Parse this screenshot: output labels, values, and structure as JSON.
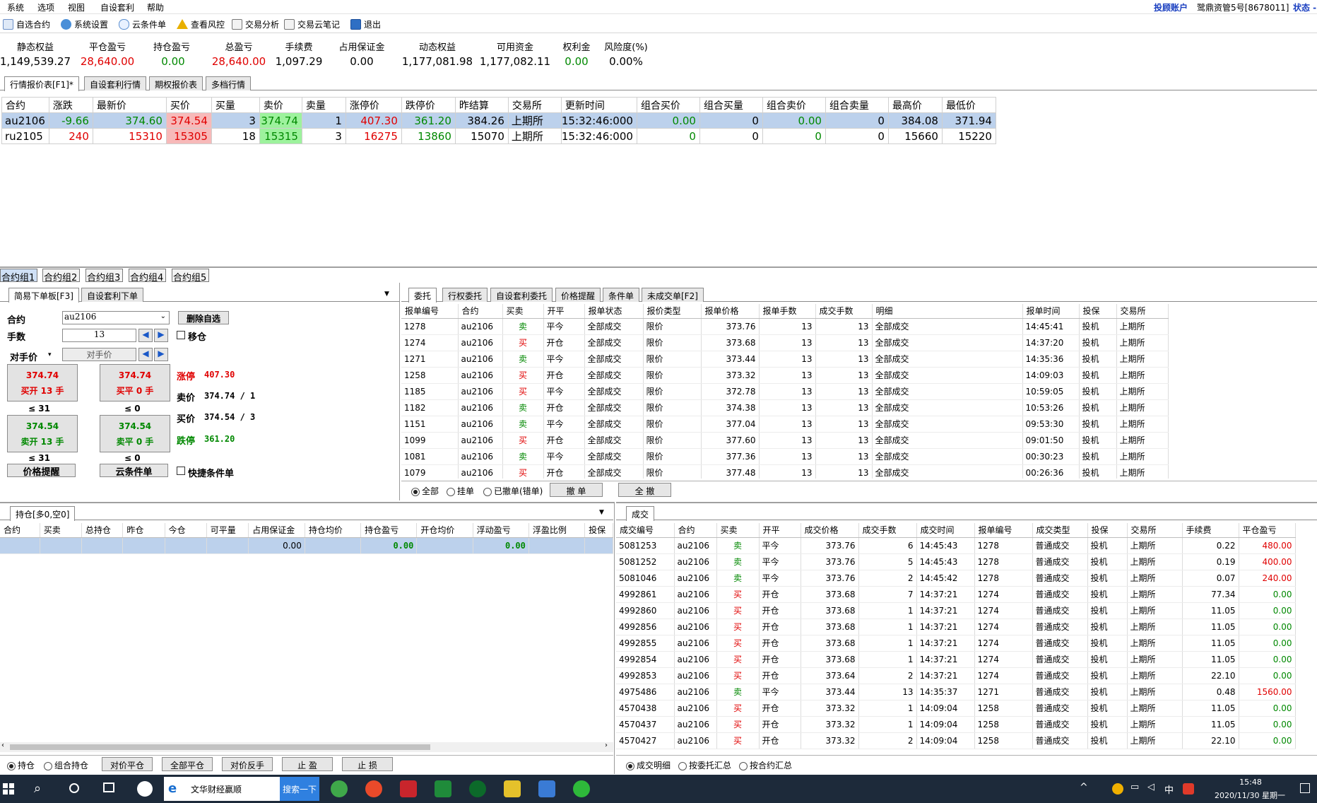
{
  "menu": [
    "系统",
    "选项",
    "视图",
    "自设套利",
    "帮助"
  ],
  "menu_right": {
    "link": "投顾账户",
    "account": "鹭鼎资管5号[8678011]",
    "status": "状态 -"
  },
  "toolbar": [
    "自选合约",
    "系统设置",
    "云条件单",
    "查看风控",
    "交易分析",
    "交易云笔记",
    "退出"
  ],
  "summary": [
    {
      "label": "静态权益",
      "value": "1,149,539.27",
      "color": "#000000"
    },
    {
      "label": "平仓盈亏",
      "value": "28,640.00",
      "color": "#e00000"
    },
    {
      "label": "持仓盈亏",
      "value": "0.00",
      "color": "#008800"
    },
    {
      "label": "总盈亏",
      "value": "28,640.00",
      "color": "#e00000"
    },
    {
      "label": "手续费",
      "value": "1,097.29",
      "color": "#000000"
    },
    {
      "label": "占用保证金",
      "value": "0.00",
      "color": "#000000"
    },
    {
      "label": "动态权益",
      "value": "1,177,081.98",
      "color": "#000000"
    },
    {
      "label": "可用资金",
      "value": "1,177,082.11",
      "color": "#000000"
    },
    {
      "label": "权利金",
      "value": "0.00",
      "color": "#008800"
    },
    {
      "label": "风险度(%)",
      "value": "0.00%",
      "color": "#000000"
    }
  ],
  "market_tabs": [
    "行情报价表[F1]*",
    "自设套利行情",
    "期权报价表",
    "多档行情"
  ],
  "market_headers": [
    "合约",
    "涨跌",
    "最新价",
    "买价",
    "买量",
    "卖价",
    "卖量",
    "涨停价",
    "跌停价",
    "昨结算",
    "交易所",
    "更新时间",
    "组合买价",
    "组合买量",
    "组合卖价",
    "组合卖量",
    "最高价",
    "最低价"
  ],
  "market_rows": [
    [
      "au2106",
      "-9.66",
      "374.60",
      "374.54",
      "3",
      "374.74",
      "1",
      "407.30",
      "361.20",
      "384.26",
      "上期所",
      "15:32:46:000",
      "0.00",
      "0",
      "0.00",
      "0",
      "384.08",
      "371.94"
    ],
    [
      "ru2105",
      "240",
      "15310",
      "15305",
      "18",
      "15315",
      "3",
      "16275",
      "13860",
      "15070",
      "上期所",
      "15:32:46:000",
      "0",
      "0",
      "0",
      "0",
      "15660",
      "15220"
    ]
  ],
  "group_tabs": [
    "合约组1",
    "合约组2",
    "合约组3",
    "合约组4",
    "合约组5"
  ],
  "order_tabs": [
    "简易下单板[F3]",
    "自设套利下单"
  ],
  "order": {
    "contract_label": "合约",
    "contract_value": "au2106",
    "delete_btn": "删除自选",
    "qty_label": "手数",
    "qty_value": "13",
    "movepos": "移仓",
    "price_mode": "对手价",
    "price_value": "对手价",
    "buy_open_price": "374.74",
    "buy_open_label": "买开 13 手",
    "buy_close_price": "374.74",
    "buy_close_label": "买平 0 手",
    "sell_open_price": "374.54",
    "sell_open_label": "卖开 13 手",
    "sell_close_price": "374.54",
    "sell_close_label": "卖平 0 手",
    "le1": "≤ 31",
    "le2": "≤ 0",
    "le3": "≤ 31",
    "le4": "≤ 0",
    "limit_up_label": "涨停",
    "limit_up": "407.30",
    "ask_label": "卖价",
    "ask": "374.74 / 1",
    "bid_label": "买价",
    "bid": "374.54 / 3",
    "limit_down_label": "跌停",
    "limit_down": "361.20",
    "price_alert": "价格提醒",
    "cloud_cond": "云条件单",
    "quick_cond": "快捷条件单"
  },
  "orders_tabs": [
    "委托",
    "行权委托",
    "自设套利委托",
    "价格提醒",
    "条件单",
    "未成交单[F2]"
  ],
  "orders_headers": [
    "报单编号",
    "合约",
    "买卖",
    "开平",
    "报单状态",
    "报价类型",
    "报单价格",
    "报单手数",
    "成交手数",
    "明细",
    "报单时间",
    "投保",
    "交易所"
  ],
  "orders_rows": [
    [
      "1278",
      "au2106",
      "卖",
      "平今",
      "全部成交",
      "限价",
      "373.76",
      "13",
      "13",
      "全部成交",
      "14:45:41",
      "投机",
      "上期所"
    ],
    [
      "1274",
      "au2106",
      "买",
      "开仓",
      "全部成交",
      "限价",
      "373.68",
      "13",
      "13",
      "全部成交",
      "14:37:20",
      "投机",
      "上期所"
    ],
    [
      "1271",
      "au2106",
      "卖",
      "平今",
      "全部成交",
      "限价",
      "373.44",
      "13",
      "13",
      "全部成交",
      "14:35:36",
      "投机",
      "上期所"
    ],
    [
      "1258",
      "au2106",
      "买",
      "开仓",
      "全部成交",
      "限价",
      "373.32",
      "13",
      "13",
      "全部成交",
      "14:09:03",
      "投机",
      "上期所"
    ],
    [
      "1185",
      "au2106",
      "买",
      "平今",
      "全部成交",
      "限价",
      "372.78",
      "13",
      "13",
      "全部成交",
      "10:59:05",
      "投机",
      "上期所"
    ],
    [
      "1182",
      "au2106",
      "卖",
      "开仓",
      "全部成交",
      "限价",
      "374.38",
      "13",
      "13",
      "全部成交",
      "10:53:26",
      "投机",
      "上期所"
    ],
    [
      "1151",
      "au2106",
      "卖",
      "平今",
      "全部成交",
      "限价",
      "377.04",
      "13",
      "13",
      "全部成交",
      "09:53:30",
      "投机",
      "上期所"
    ],
    [
      "1099",
      "au2106",
      "买",
      "开仓",
      "全部成交",
      "限价",
      "377.60",
      "13",
      "13",
      "全部成交",
      "09:01:50",
      "投机",
      "上期所"
    ],
    [
      "1081",
      "au2106",
      "卖",
      "平今",
      "全部成交",
      "限价",
      "377.36",
      "13",
      "13",
      "全部成交",
      "00:30:23",
      "投机",
      "上期所"
    ],
    [
      "1079",
      "au2106",
      "买",
      "开仓",
      "全部成交",
      "限价",
      "377.48",
      "13",
      "13",
      "全部成交",
      "00:26:36",
      "投机",
      "上期所"
    ]
  ],
  "orders_bottom": {
    "all": "全部",
    "pending": "挂单",
    "cancelled": "已撤单(错单)",
    "cancel": "撤 单",
    "cancel_all": "全 撤"
  },
  "pos_tabs": [
    "持仓[多0,空0]"
  ],
  "pos_headers": [
    "合约",
    "买卖",
    "总持仓",
    "昨仓",
    "今仓",
    "可平量",
    "占用保证金",
    "持仓均价",
    "持仓盈亏",
    "开仓均价",
    "浮动盈亏",
    "浮盈比例",
    "投保"
  ],
  "pos_row": [
    "",
    "",
    "",
    "",
    "",
    "",
    "0.00",
    "",
    "0.00",
    "",
    "0.00",
    "",
    ""
  ],
  "pos_bottom": {
    "pos": "持仓",
    "combo": "组合持仓",
    "b1": "对价平仓",
    "b2": "全部平仓",
    "b3": "对价反手",
    "b4": "止 盈",
    "b5": "止 损"
  },
  "trades_tabs": [
    "成交"
  ],
  "trades_headers": [
    "成交编号",
    "合约",
    "买卖",
    "开平",
    "成交价格",
    "成交手数",
    "成交时间",
    "报单编号",
    "成交类型",
    "投保",
    "交易所",
    "手续费",
    "平仓盈亏"
  ],
  "trades_rows": [
    [
      "5081253",
      "au2106",
      "卖",
      "平今",
      "373.76",
      "6",
      "14:45:43",
      "1278",
      "普通成交",
      "投机",
      "上期所",
      "0.22",
      "480.00"
    ],
    [
      "5081252",
      "au2106",
      "卖",
      "平今",
      "373.76",
      "5",
      "14:45:43",
      "1278",
      "普通成交",
      "投机",
      "上期所",
      "0.19",
      "400.00"
    ],
    [
      "5081046",
      "au2106",
      "卖",
      "平今",
      "373.76",
      "2",
      "14:45:42",
      "1278",
      "普通成交",
      "投机",
      "上期所",
      "0.07",
      "240.00"
    ],
    [
      "4992861",
      "au2106",
      "买",
      "开仓",
      "373.68",
      "7",
      "14:37:21",
      "1274",
      "普通成交",
      "投机",
      "上期所",
      "77.34",
      "0.00"
    ],
    [
      "4992860",
      "au2106",
      "买",
      "开仓",
      "373.68",
      "1",
      "14:37:21",
      "1274",
      "普通成交",
      "投机",
      "上期所",
      "11.05",
      "0.00"
    ],
    [
      "4992856",
      "au2106",
      "买",
      "开仓",
      "373.68",
      "1",
      "14:37:21",
      "1274",
      "普通成交",
      "投机",
      "上期所",
      "11.05",
      "0.00"
    ],
    [
      "4992855",
      "au2106",
      "买",
      "开仓",
      "373.68",
      "1",
      "14:37:21",
      "1274",
      "普通成交",
      "投机",
      "上期所",
      "11.05",
      "0.00"
    ],
    [
      "4992854",
      "au2106",
      "买",
      "开仓",
      "373.68",
      "1",
      "14:37:21",
      "1274",
      "普通成交",
      "投机",
      "上期所",
      "11.05",
      "0.00"
    ],
    [
      "4992853",
      "au2106",
      "买",
      "开仓",
      "373.64",
      "2",
      "14:37:21",
      "1274",
      "普通成交",
      "投机",
      "上期所",
      "22.10",
      "0.00"
    ],
    [
      "4975486",
      "au2106",
      "卖",
      "平今",
      "373.44",
      "13",
      "14:35:37",
      "1271",
      "普通成交",
      "投机",
      "上期所",
      "0.48",
      "1560.00"
    ],
    [
      "4570438",
      "au2106",
      "买",
      "开仓",
      "373.32",
      "1",
      "14:09:04",
      "1258",
      "普通成交",
      "投机",
      "上期所",
      "11.05",
      "0.00"
    ],
    [
      "4570437",
      "au2106",
      "买",
      "开仓",
      "373.32",
      "1",
      "14:09:04",
      "1258",
      "普通成交",
      "投机",
      "上期所",
      "11.05",
      "0.00"
    ],
    [
      "4570427",
      "au2106",
      "买",
      "开仓",
      "373.32",
      "2",
      "14:09:04",
      "1258",
      "普通成交",
      "投机",
      "上期所",
      "22.10",
      "0.00"
    ]
  ],
  "trades_bottom": {
    "detail": "成交明细",
    "by_order": "按委托汇总",
    "by_contract": "按合约汇总"
  },
  "taskbar": {
    "search_text": "文华财经赢顺",
    "search_btn": "搜索一下",
    "time": "15:48",
    "date": "2020/11/30 星期一",
    "ime": "中"
  },
  "colors": {
    "red": "#e00000",
    "green": "#008800",
    "selected": "#bcd1ec"
  }
}
